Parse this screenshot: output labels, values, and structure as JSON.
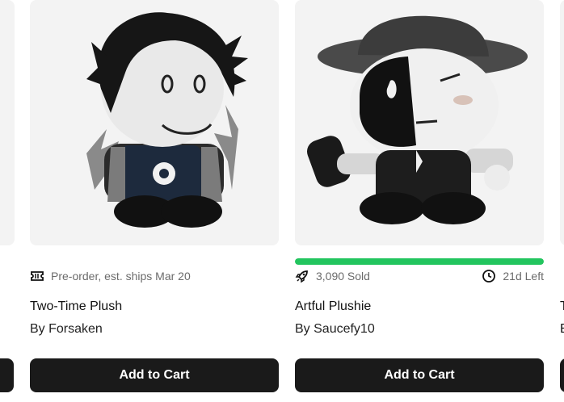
{
  "products": [
    {
      "preorder_text": "Pre-order, est. ships Mar 20",
      "name": "Two-Time Plush",
      "byline": "By Forsaken",
      "cart_label": "Add to Cart",
      "meta_icon": "ticket-icon",
      "image_icon": "plush-image"
    },
    {
      "sold_text": "3,090 Sold",
      "time_left": "21d Left",
      "sold_progress": 1.0,
      "name": "Artful Plushie",
      "byline": "By Saucefy10",
      "cart_label": "Add to Cart",
      "sold_icon": "rocket-icon",
      "time_icon": "clock-icon",
      "image_icon": "plush-image"
    }
  ],
  "edge_right": {
    "title_initial": "T",
    "byline_initial": "B"
  },
  "colors": {
    "accent_green": "#22c55e",
    "button_dark": "#1a1a1a",
    "image_bg": "#f3f3f3"
  }
}
